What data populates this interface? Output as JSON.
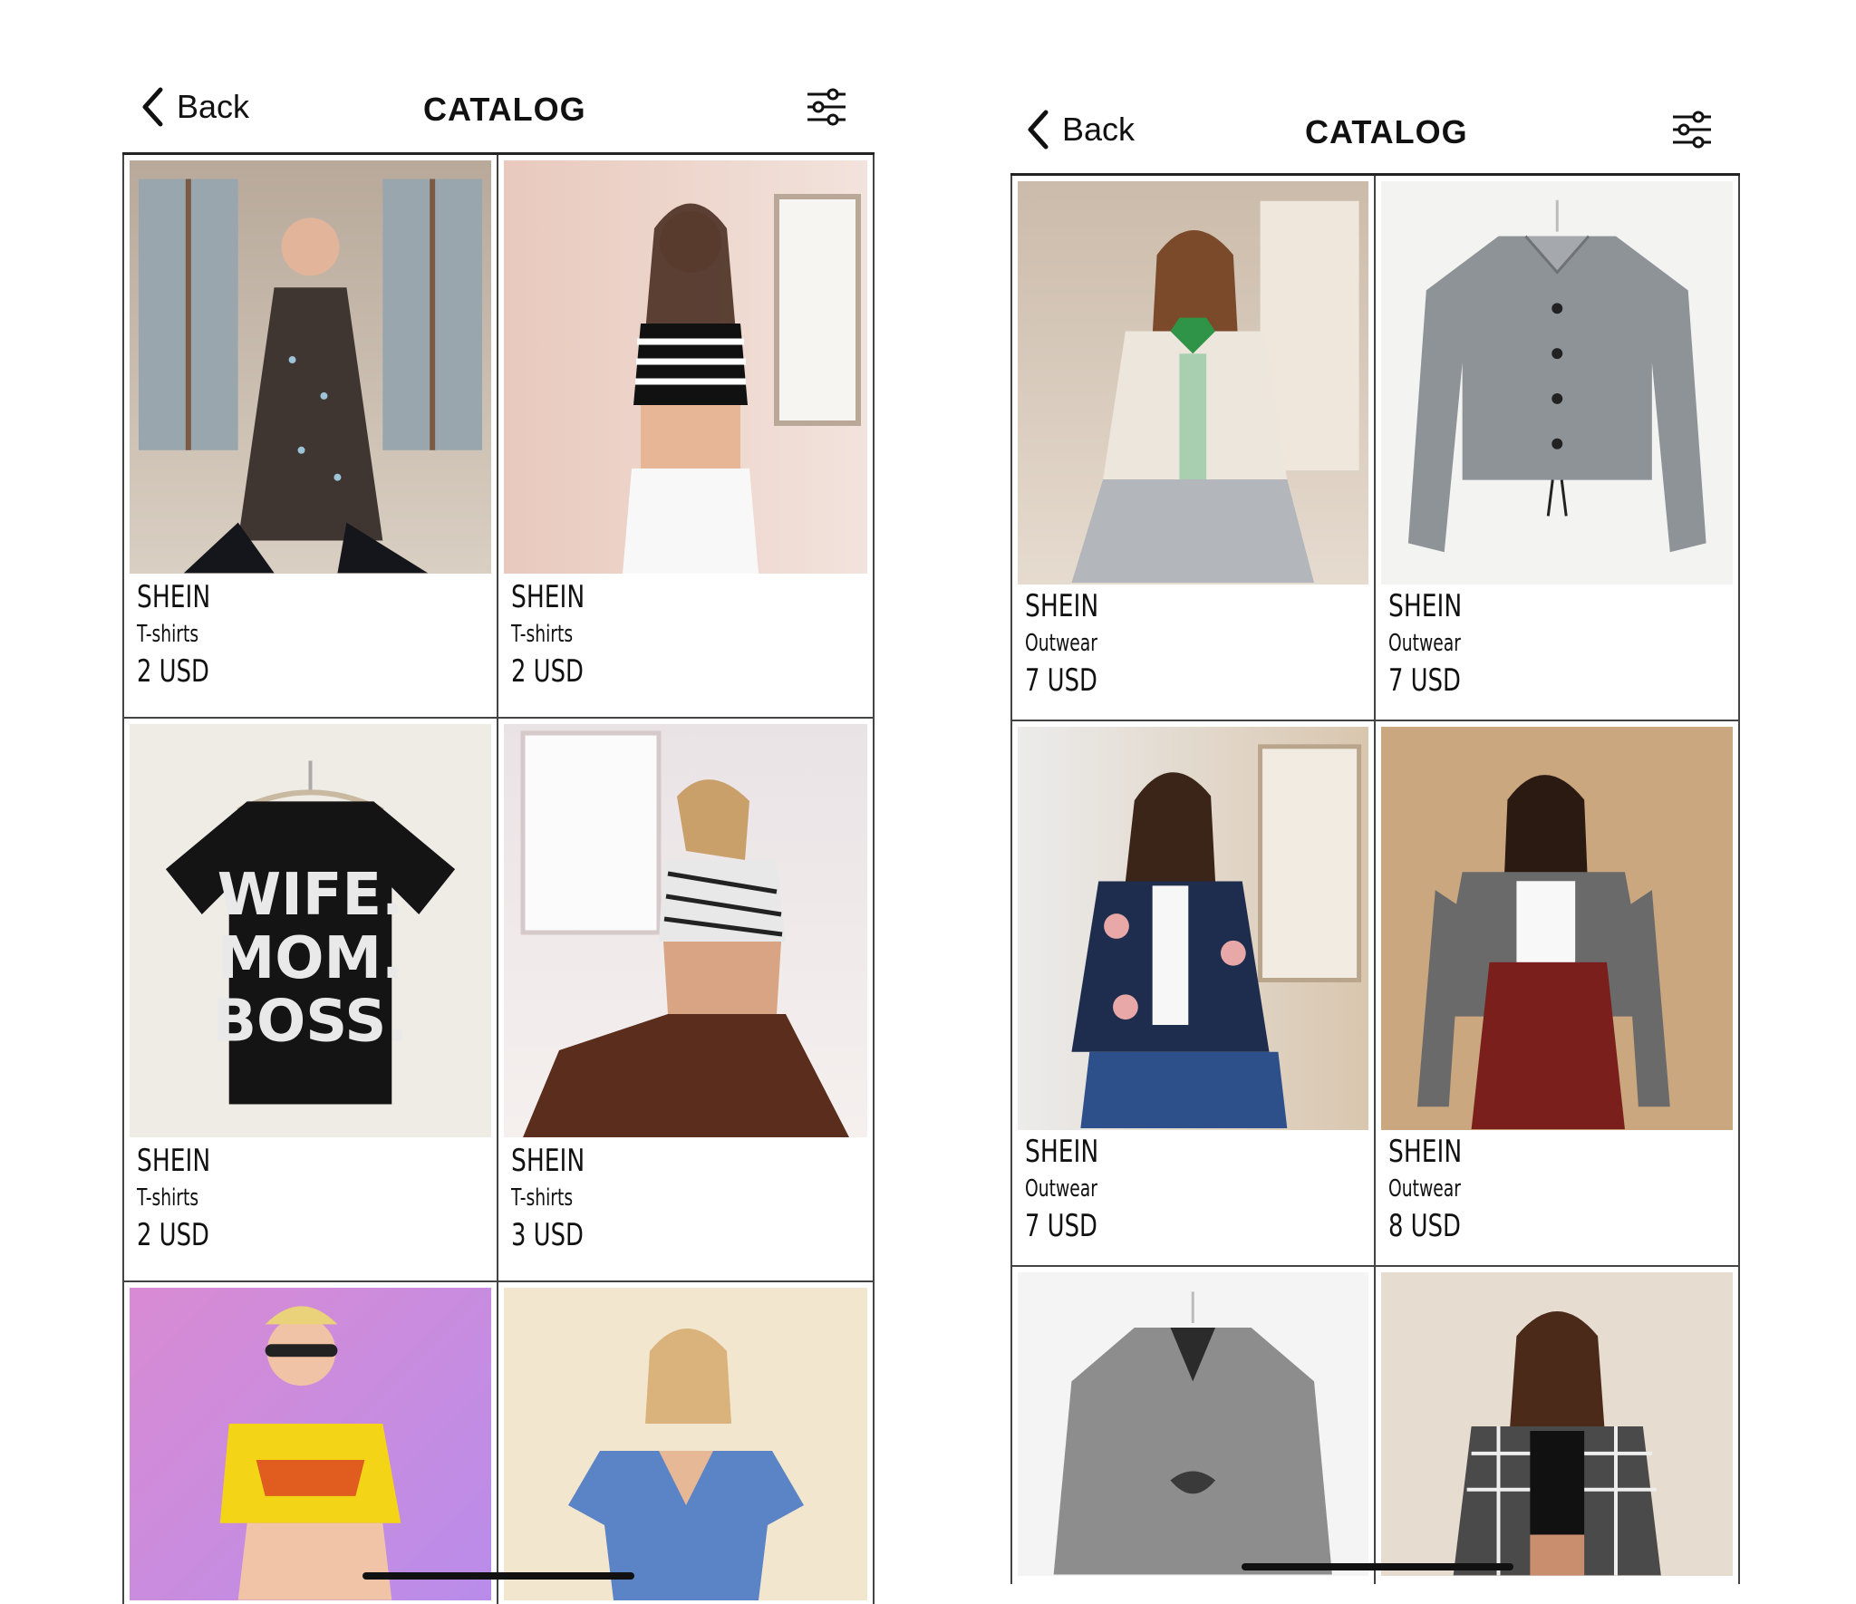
{
  "screens": [
    {
      "header": {
        "back_label": "Back",
        "title": "CATALOG"
      },
      "products": [
        {
          "brand": "SHEIN",
          "category": "T-shirts",
          "price": "2 USD"
        },
        {
          "brand": "SHEIN",
          "category": "T-shirts",
          "price": "2 USD"
        },
        {
          "brand": "SHEIN",
          "category": "T-shirts",
          "price": "2 USD",
          "print_lines": [
            "WIFE.",
            "MOM.",
            "BOSS."
          ]
        },
        {
          "brand": "SHEIN",
          "category": "T-shirts",
          "price": "3 USD"
        }
      ]
    },
    {
      "header": {
        "back_label": "Back",
        "title": "CATALOG"
      },
      "products": [
        {
          "brand": "SHEIN",
          "category": "Outwear",
          "price": "7 USD"
        },
        {
          "brand": "SHEIN",
          "category": "Outwear",
          "price": "7 USD"
        },
        {
          "brand": "SHEIN",
          "category": "Outwear",
          "price": "7 USD"
        },
        {
          "brand": "SHEIN",
          "category": "Outwear",
          "price": "8 USD"
        }
      ]
    }
  ],
  "icons": {
    "back": "chevron-left-icon",
    "filter": "filter-sliders-icon"
  }
}
